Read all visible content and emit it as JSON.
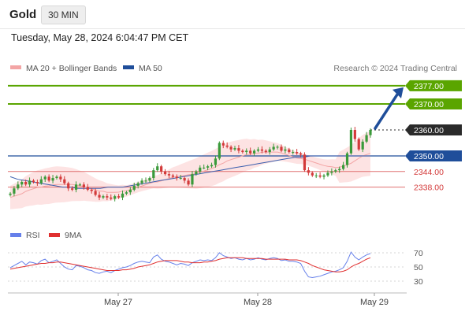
{
  "header": {
    "title": "Gold",
    "timeframe": "30 MIN"
  },
  "timestamp": "Tuesday, May 28, 2024 6:04:47 PM CET",
  "legend": {
    "ma20": "MA 20 + Bollinger Bands",
    "ma50": "MA 50",
    "rsi": "RSI",
    "ma9": "9MA",
    "credit": "Research © 2024 Trading Central"
  },
  "colors": {
    "green_level": "#5aa500",
    "blue": "#1f4e9a",
    "red_level": "#e07070",
    "band": "#fde3e3",
    "ma20": "#f3a5a5",
    "ma50": "#3b5fae",
    "candle_up": "#3a9a3a",
    "candle_down": "#d33a3a",
    "rsi": "#6680ea",
    "ma9": "#e03030",
    "current": "#2a2a2a"
  },
  "chart_data": [
    {
      "type": "candlestick",
      "title": "Gold 30 MIN",
      "x_ticks": [
        "May 27",
        "May 28",
        "May 29"
      ],
      "ylim": [
        2330,
        2380
      ],
      "levels": [
        {
          "label": "2377.00",
          "value": 2377.0,
          "kind": "target",
          "color": "#5aa500"
        },
        {
          "label": "2370.00",
          "value": 2370.0,
          "kind": "resistance",
          "color": "#5aa500"
        },
        {
          "label": "2360.00",
          "value": 2360.0,
          "kind": "current",
          "color": "#2a2a2a"
        },
        {
          "label": "2350.00",
          "value": 2350.0,
          "kind": "pivot",
          "color": "#1f4e9a"
        },
        {
          "label": "2344.00",
          "value": 2344.0,
          "kind": "support",
          "color": "#d33a3a"
        },
        {
          "label": "2338.00",
          "value": 2338.0,
          "kind": "support",
          "color": "#d33a3a"
        }
      ],
      "close": [
        2335.5,
        2337.5,
        2339.0,
        2340.0,
        2339.0,
        2340.5,
        2340.0,
        2339.5,
        2341.0,
        2342.0,
        2340.5,
        2341.5,
        2342.0,
        2341.0,
        2339.5,
        2337.5,
        2337.0,
        2339.0,
        2339.0,
        2338.0,
        2337.0,
        2336.5,
        2335.0,
        2334.0,
        2334.5,
        2334.0,
        2333.5,
        2334.5,
        2334.0,
        2335.5,
        2336.0,
        2337.0,
        2338.5,
        2339.5,
        2340.5,
        2340.5,
        2341.5,
        2344.5,
        2346.0,
        2344.0,
        2343.0,
        2342.5,
        2342.0,
        2341.5,
        2341.5,
        2340.5,
        2339.0,
        2343.0,
        2344.0,
        2345.5,
        2345.5,
        2346.0,
        2346.5,
        2349.0,
        2355.0,
        2354.0,
        2353.5,
        2352.5,
        2353.0,
        2352.0,
        2351.5,
        2352.0,
        2351.0,
        2352.0,
        2352.5,
        2352.0,
        2351.5,
        2352.5,
        2353.5,
        2353.5,
        2352.0,
        2352.5,
        2351.5,
        2351.5,
        2351.0,
        2350.5,
        2344.5,
        2343.5,
        2342.5,
        2342.5,
        2342.0,
        2342.5,
        2343.5,
        2344.0,
        2344.5,
        2345.0,
        2346.5,
        2351.0,
        2360.0,
        2356.5,
        2352.5,
        2355.5,
        2358.0,
        2360.0
      ],
      "ma20": [
        2334.0,
        2334.5,
        2335.0,
        2335.5,
        2336.5,
        2337.0,
        2337.5,
        2338.0,
        2338.0,
        2338.5,
        2338.5,
        2339.0,
        2339.0,
        2339.0,
        2339.0,
        2339.0,
        2339.0,
        2338.5,
        2338.5,
        2338.0,
        2337.5,
        2337.0,
        2336.5,
        2336.5,
        2336.0,
        2336.0,
        2336.0,
        2336.0,
        2336.5,
        2336.5,
        2337.0,
        2337.5,
        2338.0,
        2338.5,
        2339.0,
        2339.5,
        2340.0,
        2340.0,
        2340.5,
        2341.0,
        2341.5,
        2342.0,
        2342.0,
        2342.5,
        2342.5,
        2343.0,
        2343.0,
        2343.5,
        2344.0,
        2344.5,
        2345.0,
        2345.5,
        2346.5,
        2347.0,
        2348.0,
        2348.5,
        2349.0,
        2349.5,
        2350.0,
        2350.5,
        2350.5,
        2351.0,
        2351.0,
        2351.5,
        2351.5,
        2351.5,
        2351.5,
        2351.5,
        2351.0,
        2350.5,
        2350.0,
        2349.5,
        2349.0,
        2349.0,
        2348.5,
        2348.0,
        2347.5,
        2347.0,
        2346.5,
        2346.0,
        2346.0,
        2345.5,
        2345.5,
        2346.0,
        2346.5,
        2347.0,
        2348.0,
        2349.0,
        2350.0,
        2350.5,
        2351.0
      ],
      "ma50": [
        2342.0,
        2341.0,
        2340.5,
        2340.0,
        2339.5,
        2339.0,
        2338.5,
        2338.0,
        2338.0,
        2337.5,
        2337.5,
        2337.5,
        2337.5,
        2338.0,
        2338.0,
        2338.0,
        2338.5,
        2339.0,
        2339.5,
        2340.0,
        2340.5,
        2341.0,
        2341.5,
        2342.0,
        2342.5,
        2343.0,
        2343.5,
        2344.0,
        2344.5,
        2345.0,
        2345.5,
        2346.0,
        2346.5,
        2347.0,
        2347.5,
        2348.0,
        2348.5,
        2349.0,
        2349.5,
        2349.5,
        2350.0,
        2350.0,
        2350.0,
        2350.0,
        2350.0,
        2350.0,
        2350.0,
        2350.0,
        2350.0
      ],
      "annotation": {
        "type": "arrow",
        "from": 2360.0,
        "to": 2377.0
      }
    },
    {
      "type": "line",
      "title": "RSI",
      "yticks": [
        30,
        50,
        70
      ],
      "ylim": [
        20,
        80
      ],
      "series": [
        {
          "name": "RSI",
          "values": [
            49,
            52,
            55,
            58,
            53,
            57,
            56,
            54,
            59,
            61,
            56,
            58,
            60,
            55,
            50,
            47,
            46,
            52,
            51,
            49,
            46,
            45,
            42,
            41,
            43,
            44,
            42,
            45,
            47,
            49,
            50,
            52,
            55,
            57,
            58,
            57,
            56,
            64,
            67,
            61,
            58,
            57,
            55,
            53,
            55,
            54,
            52,
            56,
            58,
            60,
            59,
            60,
            59,
            63,
            70,
            66,
            64,
            62,
            63,
            61,
            60,
            62,
            60,
            61,
            63,
            61,
            60,
            62,
            63,
            62,
            59,
            60,
            58,
            58,
            57,
            55,
            44,
            36,
            35,
            36,
            37,
            39,
            41,
            43,
            44,
            46,
            49,
            58,
            71,
            64,
            60,
            64,
            67,
            69
          ]
        },
        {
          "name": "9MA",
          "values": [
            47,
            48,
            49,
            50,
            51,
            52,
            53,
            54,
            55,
            55,
            56,
            56,
            57,
            57,
            56,
            55,
            54,
            53,
            52,
            51,
            50,
            49,
            48,
            47,
            46,
            45,
            45,
            45,
            45,
            46,
            46,
            47,
            48,
            50,
            51,
            52,
            53,
            55,
            57,
            58,
            59,
            59,
            59,
            59,
            58,
            57,
            57,
            56,
            56,
            56,
            57,
            57,
            58,
            59,
            61,
            62,
            63,
            63,
            63,
            63,
            63,
            62,
            62,
            62,
            62,
            62,
            61,
            61,
            61,
            61,
            61,
            61,
            60,
            60,
            60,
            59,
            57,
            55,
            52,
            50,
            48,
            46,
            45,
            44,
            43,
            43,
            44,
            46,
            50,
            53,
            55,
            58,
            61,
            63
          ]
        }
      ]
    }
  ]
}
